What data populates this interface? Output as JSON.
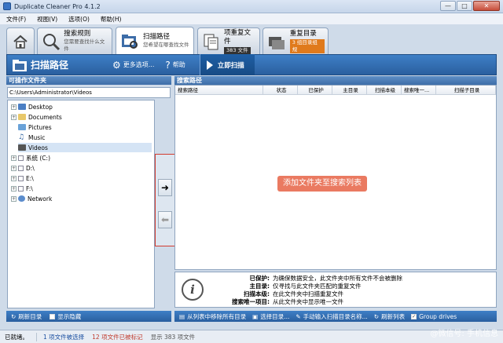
{
  "window": {
    "title": "Duplicate Cleaner Pro 4.1.2",
    "minimize": "—",
    "maximize": "□",
    "close": "✕"
  },
  "menu": [
    "文件(F)",
    "视图(V)",
    "选项(O)",
    "帮助(H)"
  ],
  "tabs": [
    {
      "title": "",
      "subtitle": ""
    },
    {
      "title": "搜索规则",
      "subtitle": "您需要查找什么文件"
    },
    {
      "title": "扫描路径",
      "subtitle": "您希望在哪查找文件"
    },
    {
      "title": "项重复文件",
      "badge": "383 文件"
    },
    {
      "title": "重复目录",
      "badge": "3 组目录组规"
    }
  ],
  "toolbar": {
    "title": "扫描路径",
    "more": "更多选项...",
    "help": "帮助",
    "scan": "立即扫描"
  },
  "left_panel": {
    "header": "可操作文件夹",
    "path": "C:\\Users\\Administrator\\Videos",
    "tree": [
      "Desktop",
      "Documents",
      "Pictures",
      "Music",
      "Videos",
      "系统 (C:)",
      "D:\\",
      "E:\\",
      "F:\\",
      "Network"
    ]
  },
  "right_panel": {
    "header": "搜索路径",
    "columns": [
      "搜索路径",
      "状态",
      "已保护",
      "主目录",
      "扫描本级",
      "搜索唯一...",
      "扫描子目录"
    ],
    "hint": "添加文件夹至搜索列表"
  },
  "info": {
    "rows": [
      {
        "key": "已保护:",
        "value": "为确保数据安全，此文件夹中所有文件不会被删除"
      },
      {
        "key": "主目录:",
        "value": "仅寻找与此文件夹匹配的重复文件"
      },
      {
        "key": "扫描本级:",
        "value": "在此文件夹中扫描重复文件"
      },
      {
        "key": "搜索唯一项目:",
        "value": "从此文件夹中显示唯一文件"
      }
    ]
  },
  "bottom_left": {
    "refresh": "刷新目录",
    "show_hidden": "显示隐藏"
  },
  "bottom_right": {
    "remove_all": "从列表中移除所有目录",
    "select_dir": "选择目录...",
    "manual": "手动输入扫描目录名称...",
    "refresh_list": "刷新列表",
    "group_drives": "Group drives"
  },
  "status": {
    "ready": "已就绪。",
    "selected": "1 项文件被选择",
    "marked": "12 项文件已被标记",
    "shown": "显示 383 项文件"
  },
  "watermark": "@微信号: 手机信息",
  "colors": {
    "accent": "#2a5f9f",
    "highlight_border": "#d23b2f",
    "hint_bg": "#ea7a61"
  }
}
